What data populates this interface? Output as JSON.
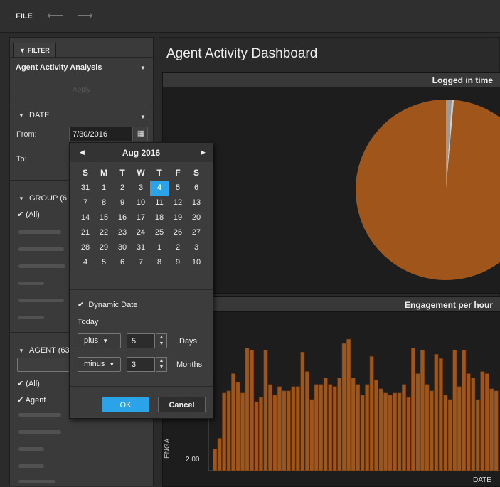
{
  "toolbar": {
    "file_label": "FILE",
    "undo_icon": "undo-arrow-icon",
    "redo_icon": "redo-arrow-icon"
  },
  "filter_panel": {
    "tab_label": "FILTER",
    "analysis_title": "Agent Activity Analysis",
    "apply_label": "Apply",
    "date_section": "DATE",
    "from_label": "From:",
    "from_value": "7/30/2016",
    "to_label": "To:",
    "group_section": "GROUP (6",
    "group_all": "(All)",
    "agent_section": "AGENT (63",
    "agent_all": "(All)",
    "agent_item": "Agent"
  },
  "date_picker": {
    "month_label": "Aug  2016",
    "weekdays": [
      "S",
      "M",
      "T",
      "W",
      "T",
      "F",
      "S"
    ],
    "weeks": [
      [
        "31",
        "1",
        "2",
        "3",
        "4",
        "5",
        "6"
      ],
      [
        "7",
        "8",
        "9",
        "10",
        "11",
        "12",
        "13"
      ],
      [
        "14",
        "15",
        "16",
        "17",
        "18",
        "19",
        "20"
      ],
      [
        "21",
        "22",
        "23",
        "24",
        "25",
        "26",
        "27"
      ],
      [
        "28",
        "29",
        "30",
        "31",
        "1",
        "2",
        "3"
      ],
      [
        "4",
        "5",
        "6",
        "7",
        "8",
        "9",
        "10"
      ]
    ],
    "selected_day": "4",
    "dynamic_date_label": "Dynamic Date",
    "today_label": "Today",
    "row1_op": "plus",
    "row1_value": "5",
    "row1_unit": "Days",
    "row2_op": "minus",
    "row2_value": "3",
    "row2_unit": "Months",
    "ok_label": "OK",
    "cancel_label": "Cancel"
  },
  "dashboard": {
    "title": "Agent Activity Dashboard",
    "pie_title": "Logged in time",
    "bar_title": "Engagement per hour",
    "bar_ylabel": "ENGA",
    "bar_ytick_visible": "2.00",
    "bar_xlabel": "DATE"
  },
  "colors": {
    "accent": "#2aa3e8",
    "bar": "#a0561a",
    "pie": "#a0561a"
  },
  "chart_data": [
    {
      "type": "pie",
      "title": "Logged in time",
      "slices": [
        {
          "value": 98.6,
          "color": "#a0561a"
        },
        {
          "value": 1.0,
          "color": "#9a9a9a"
        },
        {
          "value": 0.4,
          "color": "#d0d0d0"
        }
      ]
    },
    {
      "type": "bar",
      "title": "Engagement per hour",
      "xlabel": "DATE",
      "ylabel": "ENGA",
      "values": [
        1.0,
        1.5,
        3.6,
        3.7,
        4.5,
        4.1,
        3.6,
        5.7,
        5.6,
        3.2,
        3.4,
        5.6,
        4.0,
        3.5,
        3.9,
        3.7,
        3.7,
        3.9,
        3.9,
        5.5,
        4.6,
        3.3,
        4.0,
        4.0,
        4.3,
        4.0,
        3.9,
        4.3,
        5.9,
        6.1,
        4.3,
        4.0,
        3.5,
        4.0,
        5.3,
        4.2,
        3.8,
        3.6,
        3.5,
        3.6,
        3.6,
        4.0,
        3.4,
        5.7,
        4.5,
        5.6,
        4.0,
        3.7,
        5.4,
        5.2,
        3.5,
        3.3,
        5.6,
        3.9,
        5.6,
        4.5,
        4.3,
        3.3,
        4.6,
        4.5,
        3.8,
        3.7
      ]
    }
  ]
}
